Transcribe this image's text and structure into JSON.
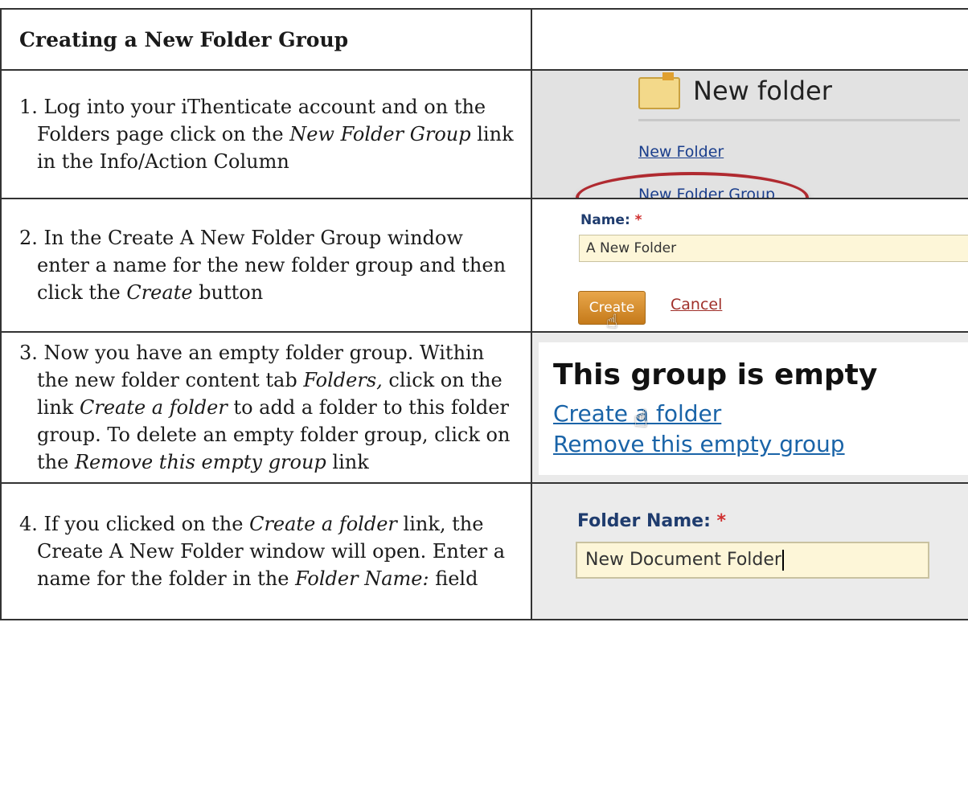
{
  "table": {
    "title": "Creating a New Folder Group"
  },
  "steps": [
    {
      "num": "1.",
      "parts": [
        "Log into your iThenticate account and on the Folders page click on the ",
        "New Folder Group",
        " link in the Info/Action Column"
      ]
    },
    {
      "num": "2.",
      "parts": [
        "In the Create A New Folder Group window enter a name for the new folder group and then click the ",
        "Create",
        " button"
      ]
    },
    {
      "num": "3.",
      "parts": [
        "Now you have an empty folder group. Within the new folder content tab ",
        "Folders,",
        " click on the link ",
        "Create a folder",
        " to add a folder to this folder group. To delete an empty folder group, click on the ",
        "Remove this empty group",
        " link"
      ]
    },
    {
      "num": "4.",
      "parts": [
        "If you clicked on the ",
        "Create a folder",
        " link, the Create A New Folder window will open. Enter a name for the folder in the ",
        "Folder Name:",
        " field"
      ]
    }
  ],
  "shot1": {
    "title": "New folder",
    "link1": "New Folder",
    "link2": "New Folder Group",
    "highlight_color": "#b02a30"
  },
  "shot2": {
    "label": "Name:",
    "required": "*",
    "input_value": "A New Folder",
    "create_label": "Create",
    "cancel_label": "Cancel",
    "button_color": "#d48d30"
  },
  "shot3": {
    "heading": "This group is empty",
    "link_create": "Create a folder",
    "link_remove": "Remove this empty group",
    "link_color": "#1a64a8"
  },
  "shot4": {
    "label": "Folder Name:",
    "required": "*",
    "input_value": "New Document Folder"
  },
  "icons": [
    "folder-icon",
    "hand-pointer-icon"
  ]
}
